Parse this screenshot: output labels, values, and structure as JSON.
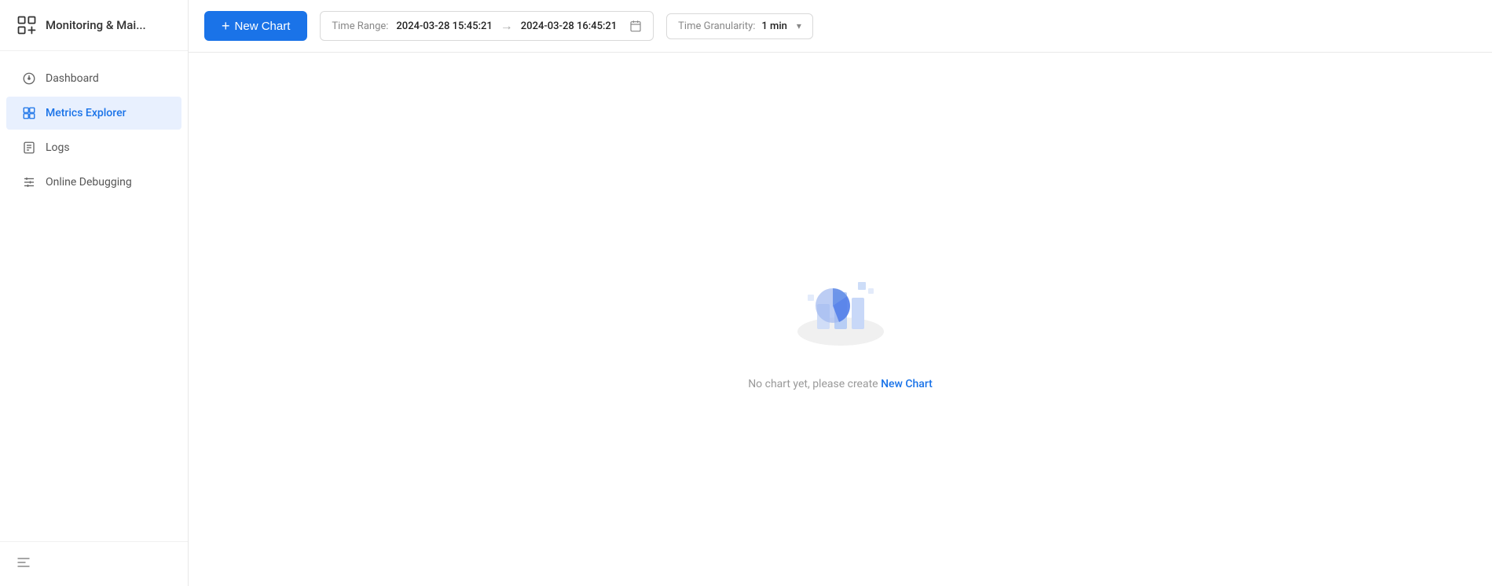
{
  "app": {
    "title": "Monitoring & Mai..."
  },
  "sidebar": {
    "items": [
      {
        "id": "dashboard",
        "label": "Dashboard",
        "active": false
      },
      {
        "id": "metrics-explorer",
        "label": "Metrics Explorer",
        "active": true
      },
      {
        "id": "logs",
        "label": "Logs",
        "active": false
      },
      {
        "id": "online-debugging",
        "label": "Online Debugging",
        "active": false
      }
    ]
  },
  "toolbar": {
    "new_chart_label": "New Chart",
    "time_range_label": "Time Range:",
    "time_start": "2024-03-28 15:45:21",
    "time_end": "2024-03-28 16:45:21",
    "granularity_label": "Time Granularity:",
    "granularity_value": "1 min"
  },
  "empty_state": {
    "message": "No chart yet, please create ",
    "link_text": "New Chart"
  }
}
